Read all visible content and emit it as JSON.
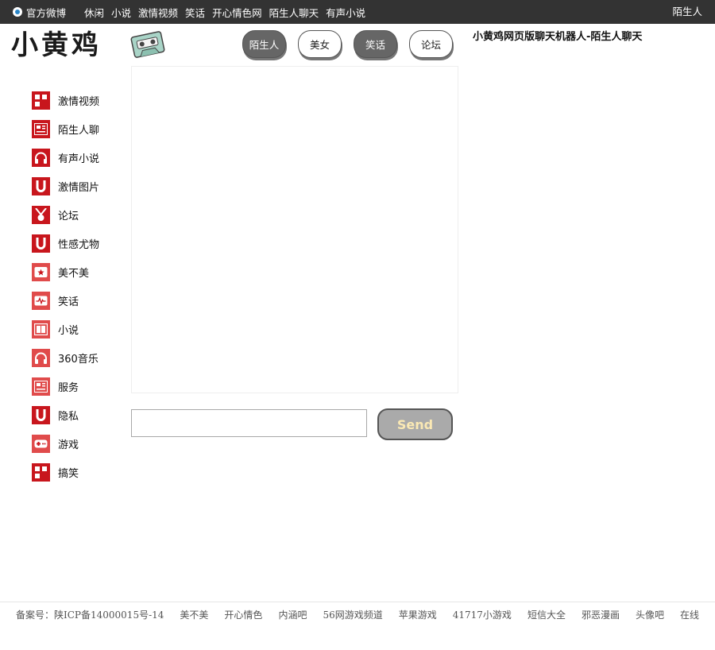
{
  "topbar": {
    "weibo": "官方微博",
    "nav": [
      "休闲",
      "小说",
      "激情视频",
      "笑话",
      "开心情色网",
      "陌生人聊天",
      "有声小说"
    ],
    "right": "陌生人"
  },
  "logo": {
    "text": "小黄鸡"
  },
  "tabs": [
    {
      "label": "陌生人",
      "style": "dark"
    },
    {
      "label": "美女",
      "style": "light"
    },
    {
      "label": "笑话",
      "style": "dark"
    },
    {
      "label": "论坛",
      "style": "light"
    }
  ],
  "page_title": "小黄鸡网页版聊天机器人-陌生人聊天",
  "sidebar": {
    "items": [
      {
        "label": "激情视频",
        "icon": "grid-icon"
      },
      {
        "label": "陌生人聊",
        "icon": "newspaper-icon"
      },
      {
        "label": "有声小说",
        "icon": "headphones-icon"
      },
      {
        "label": "激情图片",
        "icon": "u-icon"
      },
      {
        "label": "论坛",
        "icon": "medal-icon"
      },
      {
        "label": "性感尤物",
        "icon": "u-icon"
      },
      {
        "label": "美不美",
        "icon": "star-icon"
      },
      {
        "label": "笑话",
        "icon": "pulse-icon"
      },
      {
        "label": "小说",
        "icon": "book-icon"
      },
      {
        "label": "360音乐",
        "icon": "headphones-icon"
      },
      {
        "label": "服务",
        "icon": "newspaper-icon"
      },
      {
        "label": "隐私",
        "icon": "u-icon"
      },
      {
        "label": "游戏",
        "icon": "gamepad-icon"
      },
      {
        "label": "搞笑",
        "icon": "grid-icon"
      }
    ]
  },
  "chat": {
    "input_value": "",
    "input_placeholder": "",
    "send_label": "Send"
  },
  "footer": {
    "icp": "备案号：陕ICP备14000015号-14",
    "links": [
      "美不美",
      "开心情色",
      "内涵吧",
      "56网游戏频道",
      "苹果游戏",
      "41717小游戏",
      "短信大全",
      "邪恶漫画",
      "头像吧",
      "在线"
    ]
  },
  "colors": {
    "topbar": "#333333",
    "icon_red": "#c8161d",
    "send_bg": "#aaaaaa",
    "send_text": "#fbe9b4",
    "tab_dark": "#666666"
  }
}
